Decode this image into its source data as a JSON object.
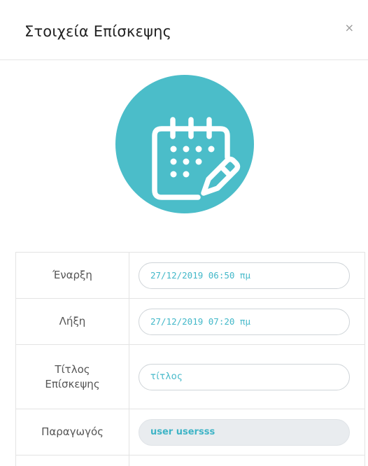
{
  "modal": {
    "title": "Στοιχεία Επίσκεψης",
    "close_symbol": "×"
  },
  "hero": {
    "icon": "calendar-edit-icon",
    "background_color": "#4bbdc9",
    "icon_color": "#ffffff"
  },
  "fields": {
    "start": {
      "label": "Έναρξη",
      "value": "27/12/2019 06:50 πμ"
    },
    "end": {
      "label": "Λήξη",
      "value": "27/12/2019 07:20 πμ"
    },
    "title": {
      "label_line1": "Τίτλος",
      "label_line2": "Επίσκεψης",
      "value": "τίτλος"
    },
    "producer": {
      "label": "Παραγωγός",
      "value": "user usersss"
    }
  },
  "colors": {
    "accent": "#43b8c9",
    "border": "#e3e3e3"
  }
}
